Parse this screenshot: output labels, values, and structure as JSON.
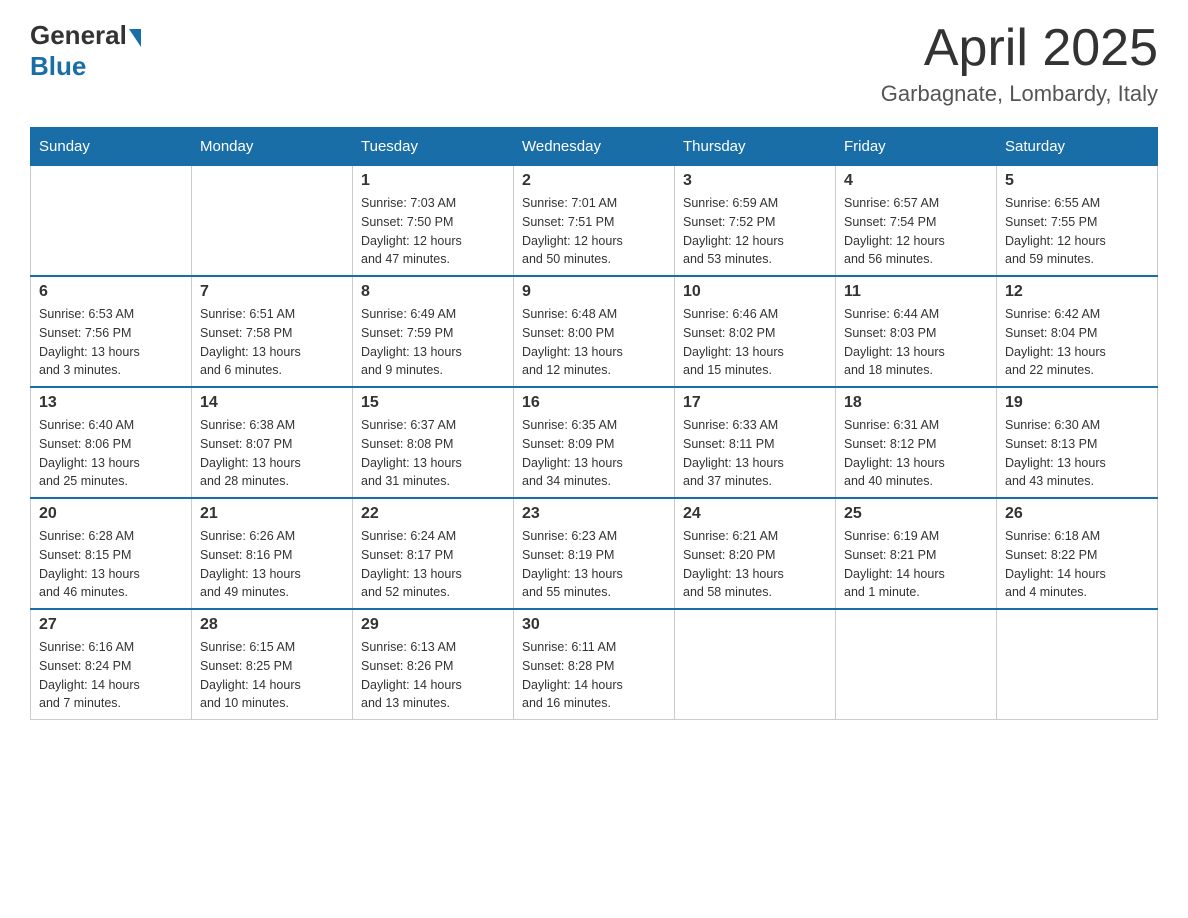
{
  "header": {
    "logo_general": "General",
    "logo_blue": "Blue",
    "month_title": "April 2025",
    "location": "Garbagnate, Lombardy, Italy"
  },
  "days_of_week": [
    "Sunday",
    "Monday",
    "Tuesday",
    "Wednesday",
    "Thursday",
    "Friday",
    "Saturday"
  ],
  "weeks": [
    [
      {
        "day": "",
        "info": ""
      },
      {
        "day": "",
        "info": ""
      },
      {
        "day": "1",
        "info": "Sunrise: 7:03 AM\nSunset: 7:50 PM\nDaylight: 12 hours\nand 47 minutes."
      },
      {
        "day": "2",
        "info": "Sunrise: 7:01 AM\nSunset: 7:51 PM\nDaylight: 12 hours\nand 50 minutes."
      },
      {
        "day": "3",
        "info": "Sunrise: 6:59 AM\nSunset: 7:52 PM\nDaylight: 12 hours\nand 53 minutes."
      },
      {
        "day": "4",
        "info": "Sunrise: 6:57 AM\nSunset: 7:54 PM\nDaylight: 12 hours\nand 56 minutes."
      },
      {
        "day": "5",
        "info": "Sunrise: 6:55 AM\nSunset: 7:55 PM\nDaylight: 12 hours\nand 59 minutes."
      }
    ],
    [
      {
        "day": "6",
        "info": "Sunrise: 6:53 AM\nSunset: 7:56 PM\nDaylight: 13 hours\nand 3 minutes."
      },
      {
        "day": "7",
        "info": "Sunrise: 6:51 AM\nSunset: 7:58 PM\nDaylight: 13 hours\nand 6 minutes."
      },
      {
        "day": "8",
        "info": "Sunrise: 6:49 AM\nSunset: 7:59 PM\nDaylight: 13 hours\nand 9 minutes."
      },
      {
        "day": "9",
        "info": "Sunrise: 6:48 AM\nSunset: 8:00 PM\nDaylight: 13 hours\nand 12 minutes."
      },
      {
        "day": "10",
        "info": "Sunrise: 6:46 AM\nSunset: 8:02 PM\nDaylight: 13 hours\nand 15 minutes."
      },
      {
        "day": "11",
        "info": "Sunrise: 6:44 AM\nSunset: 8:03 PM\nDaylight: 13 hours\nand 18 minutes."
      },
      {
        "day": "12",
        "info": "Sunrise: 6:42 AM\nSunset: 8:04 PM\nDaylight: 13 hours\nand 22 minutes."
      }
    ],
    [
      {
        "day": "13",
        "info": "Sunrise: 6:40 AM\nSunset: 8:06 PM\nDaylight: 13 hours\nand 25 minutes."
      },
      {
        "day": "14",
        "info": "Sunrise: 6:38 AM\nSunset: 8:07 PM\nDaylight: 13 hours\nand 28 minutes."
      },
      {
        "day": "15",
        "info": "Sunrise: 6:37 AM\nSunset: 8:08 PM\nDaylight: 13 hours\nand 31 minutes."
      },
      {
        "day": "16",
        "info": "Sunrise: 6:35 AM\nSunset: 8:09 PM\nDaylight: 13 hours\nand 34 minutes."
      },
      {
        "day": "17",
        "info": "Sunrise: 6:33 AM\nSunset: 8:11 PM\nDaylight: 13 hours\nand 37 minutes."
      },
      {
        "day": "18",
        "info": "Sunrise: 6:31 AM\nSunset: 8:12 PM\nDaylight: 13 hours\nand 40 minutes."
      },
      {
        "day": "19",
        "info": "Sunrise: 6:30 AM\nSunset: 8:13 PM\nDaylight: 13 hours\nand 43 minutes."
      }
    ],
    [
      {
        "day": "20",
        "info": "Sunrise: 6:28 AM\nSunset: 8:15 PM\nDaylight: 13 hours\nand 46 minutes."
      },
      {
        "day": "21",
        "info": "Sunrise: 6:26 AM\nSunset: 8:16 PM\nDaylight: 13 hours\nand 49 minutes."
      },
      {
        "day": "22",
        "info": "Sunrise: 6:24 AM\nSunset: 8:17 PM\nDaylight: 13 hours\nand 52 minutes."
      },
      {
        "day": "23",
        "info": "Sunrise: 6:23 AM\nSunset: 8:19 PM\nDaylight: 13 hours\nand 55 minutes."
      },
      {
        "day": "24",
        "info": "Sunrise: 6:21 AM\nSunset: 8:20 PM\nDaylight: 13 hours\nand 58 minutes."
      },
      {
        "day": "25",
        "info": "Sunrise: 6:19 AM\nSunset: 8:21 PM\nDaylight: 14 hours\nand 1 minute."
      },
      {
        "day": "26",
        "info": "Sunrise: 6:18 AM\nSunset: 8:22 PM\nDaylight: 14 hours\nand 4 minutes."
      }
    ],
    [
      {
        "day": "27",
        "info": "Sunrise: 6:16 AM\nSunset: 8:24 PM\nDaylight: 14 hours\nand 7 minutes."
      },
      {
        "day": "28",
        "info": "Sunrise: 6:15 AM\nSunset: 8:25 PM\nDaylight: 14 hours\nand 10 minutes."
      },
      {
        "day": "29",
        "info": "Sunrise: 6:13 AM\nSunset: 8:26 PM\nDaylight: 14 hours\nand 13 minutes."
      },
      {
        "day": "30",
        "info": "Sunrise: 6:11 AM\nSunset: 8:28 PM\nDaylight: 14 hours\nand 16 minutes."
      },
      {
        "day": "",
        "info": ""
      },
      {
        "day": "",
        "info": ""
      },
      {
        "day": "",
        "info": ""
      }
    ]
  ]
}
